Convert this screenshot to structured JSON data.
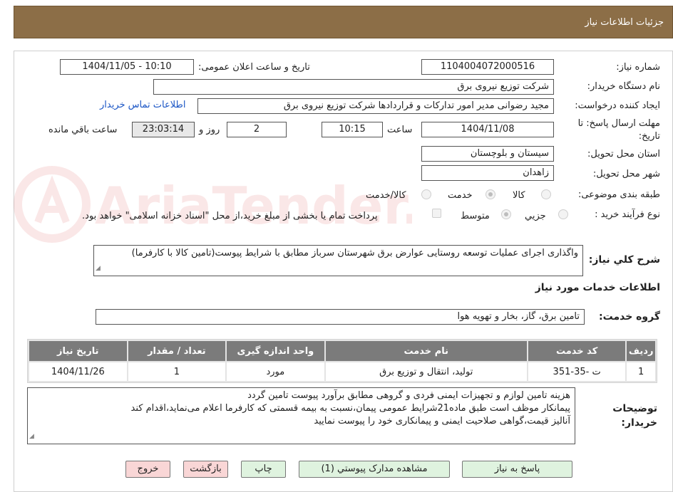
{
  "header": {
    "title": "جزئیات اطلاعات نیاز"
  },
  "form": {
    "need_number_label": "شماره نیاز:",
    "need_number": "1104004072000516",
    "announce_label": "تاریخ و ساعت اعلان عمومی:",
    "announce_value": "1404/11/05 - 10:10",
    "buyer_org_label": "نام دستگاه خریدار:",
    "buyer_org": "شرکت توزیع نیروی برق",
    "creator_label": "ایجاد کننده درخواست:",
    "creator": "مجید  رضوانی مدیر امور تدارکات و قراردادها شرکت توزیع نیروی برق",
    "contact_link": "اطلاعات تماس خریدار",
    "deadline_label_line1": "مهلت ارسال پاسخ: تا",
    "deadline_label_line2": "تاریخ:",
    "deadline_date": "1404/11/08",
    "time_word": "ساعت",
    "deadline_time": "10:15",
    "days": "2",
    "days_word": "روز و",
    "remaining_time": "23:03:14",
    "remaining_word": "ساعت باقي مانده",
    "province_label": "استان محل تحویل:",
    "province": "سیستان و بلوچستان",
    "city_label": "شهر محل تحویل:",
    "city": "زاهدان",
    "category_label": "طبقه بندی موضوعی:",
    "category_options": [
      "کالا",
      "خدمت",
      "کالا/خدمت"
    ],
    "category_selected": "خدمت",
    "process_label": "نوع فرآیند خرید :",
    "process_options": [
      "جزيي",
      "متوسط"
    ],
    "process_selected": "متوسط",
    "payment_note": "پرداخت تمام یا بخشی از مبلغ خرید،از محل \"اسناد خزانه اسلامی\" خواهد بود."
  },
  "summary": {
    "label": "شرح کلي نیاز:",
    "text": "واگذاری اجرای عملیات توسعه روستایی عوارض برق شهرستان سرباز مطابق با شرایط پیوست(تامین کالا با کارفرما)"
  },
  "services": {
    "section_title": "اطلاعات خدمات مورد نیاز",
    "group_label": "گروه خدمت:",
    "group_value": "تامین برق، گاز، بخار و تهویه هوا",
    "table": {
      "headers": [
        "ردیف",
        "کد خدمت",
        "نام خدمت",
        "واحد اندازه گیری",
        "تعداد / مقدار",
        "تاریخ نیاز"
      ],
      "rows": [
        [
          "1",
          "ت -35-351",
          "تولید، انتقال و توزیع برق",
          "مورد",
          "1",
          "1404/11/26"
        ]
      ]
    }
  },
  "buyer_notes": {
    "label_line1": "توضیحات",
    "label_line2": "خریدار:",
    "lines": [
      "هزینه تامین لوازم و تجهیزات ایمنی فردی و گروهی مطابق برآورد پیوست تامین گردد",
      "پیمانکار موظف است طبق ماده21شرایط عمومی پیمان،نسبت به بیمه قسمتی که کارفرما اعلام می‌نماید،اقدام کند",
      "آنالیز قیمت،گواهی صلاحیت ایمنی و پیمانکاری خود را پیوست نمایید"
    ]
  },
  "buttons": {
    "reply": "پاسخ به نیاز",
    "attachments": "مشاهده مدارک پیوستي (1)",
    "print": "چاپ",
    "back": "بازگشت",
    "exit": "خروج"
  },
  "watermark": {
    "text": "AriaTender.neT"
  },
  "colors": {
    "header_bg": "#8c6e47",
    "link": "#1a55c5",
    "table_header": "#7b7b7b"
  }
}
